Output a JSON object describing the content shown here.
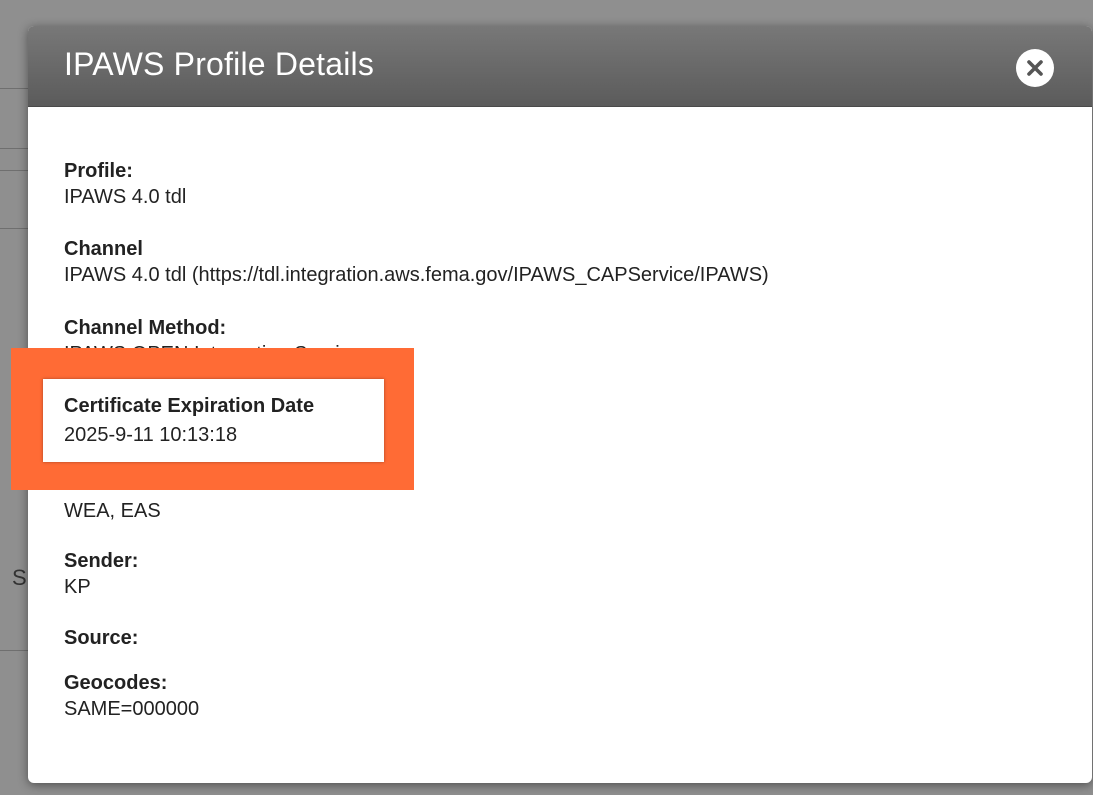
{
  "modal": {
    "title": "IPAWS Profile Details",
    "close_icon": "close-icon"
  },
  "fields": [
    {
      "label": "Profile:",
      "value": "IPAWS 4.0 tdl"
    },
    {
      "label": "Channel",
      "value": "IPAWS 4.0 tdl (https://tdl.integration.aws.fema.gov/IPAWS_CAPService/IPAWS)"
    },
    {
      "label": "Channel Method:",
      "value": "IPAWS OPEN Integration Service"
    },
    {
      "label": "",
      "value": ""
    },
    {
      "label": "",
      "value": "WEA, EAS"
    },
    {
      "label": "Sender:",
      "value": "KP"
    },
    {
      "label": "Source:",
      "value": ""
    },
    {
      "label": "Geocodes:",
      "value": "SAME=000000"
    }
  ],
  "highlight": {
    "label": "Certificate Expiration Date",
    "value": "2025-9-11 10:13:18",
    "color": "#ff6b35"
  },
  "background": {
    "fragment": "S"
  }
}
